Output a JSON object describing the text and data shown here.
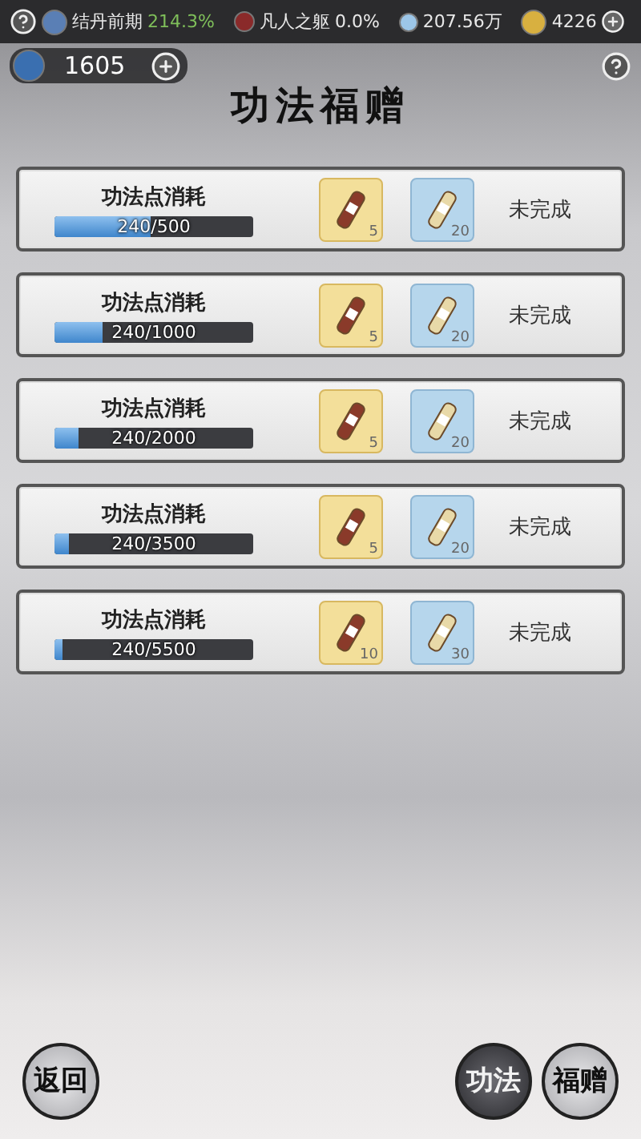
{
  "status_bar": {
    "realm": "结丹前期",
    "realm_percent": "214.3%",
    "body": "凡人之躯",
    "body_percent": "0.0%",
    "spirit_stones": "207.56万",
    "gold": "4226"
  },
  "points": {
    "value": "1605"
  },
  "title": "功法福赠",
  "tasks": [
    {
      "label": "功法点消耗",
      "progress": "240/500",
      "level": 0.48,
      "rewards": [
        {
          "kind": "gold",
          "count": "5"
        },
        {
          "kind": "blue",
          "count": "20"
        }
      ],
      "status": "未完成"
    },
    {
      "label": "功法点消耗",
      "progress": "240/1000",
      "level": 0.24,
      "rewards": [
        {
          "kind": "gold",
          "count": "5"
        },
        {
          "kind": "blue",
          "count": "20"
        }
      ],
      "status": "未完成"
    },
    {
      "label": "功法点消耗",
      "progress": "240/2000",
      "level": 0.12,
      "rewards": [
        {
          "kind": "gold",
          "count": "5"
        },
        {
          "kind": "blue",
          "count": "20"
        }
      ],
      "status": "未完成"
    },
    {
      "label": "功法点消耗",
      "progress": "240/3500",
      "level": 0.069,
      "rewards": [
        {
          "kind": "gold",
          "count": "5"
        },
        {
          "kind": "blue",
          "count": "20"
        }
      ],
      "status": "未完成"
    },
    {
      "label": "功法点消耗",
      "progress": "240/5500",
      "level": 0.044,
      "rewards": [
        {
          "kind": "gold",
          "count": "10"
        },
        {
          "kind": "blue",
          "count": "30"
        }
      ],
      "status": "未完成"
    }
  ],
  "bottom_buttons": [
    {
      "kind": "light",
      "label": "返回"
    },
    {
      "kind": "dark",
      "label": "功法"
    },
    {
      "kind": "light",
      "label": "福赠"
    }
  ]
}
